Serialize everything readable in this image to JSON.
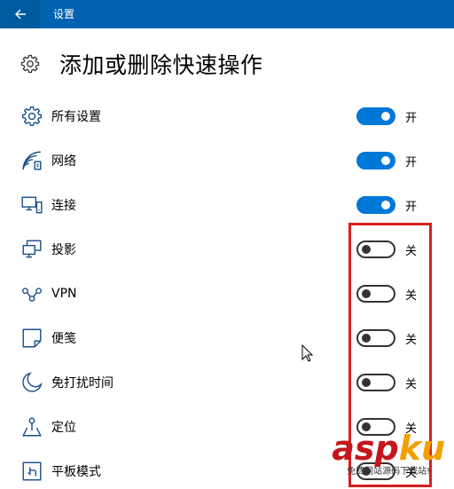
{
  "titlebar": {
    "app_title": "设置",
    "back_icon": "arrow-left-icon",
    "color": "#0063b1"
  },
  "header": {
    "title": "添加或删除快速操作",
    "icon": "gear-icon"
  },
  "accent": "#0078d7",
  "items": [
    {
      "label": "所有设置",
      "icon": "gear-icon",
      "on": true,
      "state": "开"
    },
    {
      "label": "网络",
      "icon": "network-icon",
      "on": true,
      "state": "开"
    },
    {
      "label": "连接",
      "icon": "connect-icon",
      "on": true,
      "state": "开"
    },
    {
      "label": "投影",
      "icon": "project-icon",
      "on": false,
      "state": "关"
    },
    {
      "label": "VPN",
      "icon": "vpn-icon",
      "on": false,
      "state": "关"
    },
    {
      "label": "便笺",
      "icon": "note-icon",
      "on": false,
      "state": "关"
    },
    {
      "label": "免打扰时间",
      "icon": "moon-icon",
      "on": false,
      "state": "关"
    },
    {
      "label": "定位",
      "icon": "location-icon",
      "on": false,
      "state": "关"
    },
    {
      "label": "平板模式",
      "icon": "tablet-icon",
      "on": false,
      "state": "关"
    }
  ],
  "watermark": {
    "logo_a": "asp",
    "logo_b": "ku",
    "sub": "免费网站源码下载站!"
  }
}
